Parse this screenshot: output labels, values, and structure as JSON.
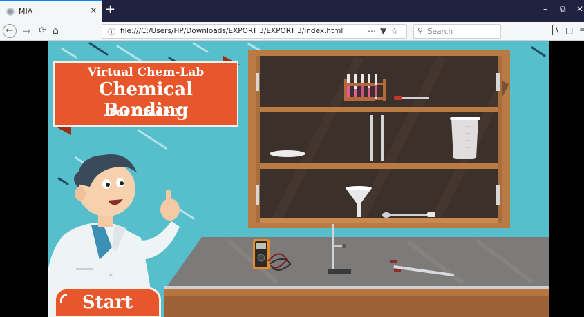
{
  "browser": {
    "tab_title": "MIA",
    "tab_close": "×",
    "new_tab": "+",
    "url": "file:///C:/Users/HP/Downloads/EXPORT 3/EXPORT 3/index.html",
    "search_placeholder": "Search",
    "icons": [
      "back-icon",
      "forward-icon",
      "reload-icon",
      "home-icon",
      "info-icon",
      "more-icon",
      "pocket-icon",
      "bookmark-star-icon",
      "search-icon",
      "library-icon",
      "sidebar-icon",
      "menu-icon",
      "minimize-icon",
      "restore-icon",
      "close-icon"
    ]
  },
  "app": {
    "title_top": "Virtual Chem-Lab",
    "title_main": "Chemical Bonding",
    "title_sub": "For Grade X",
    "start_label": "Start"
  },
  "colors": {
    "background": "#57bfcc",
    "accent": "#e8562b",
    "cabinet": "#b97a43",
    "cabinet_interior": "#3c302a",
    "table_top": "#7d7b7a",
    "table_front": "#9b6237"
  }
}
